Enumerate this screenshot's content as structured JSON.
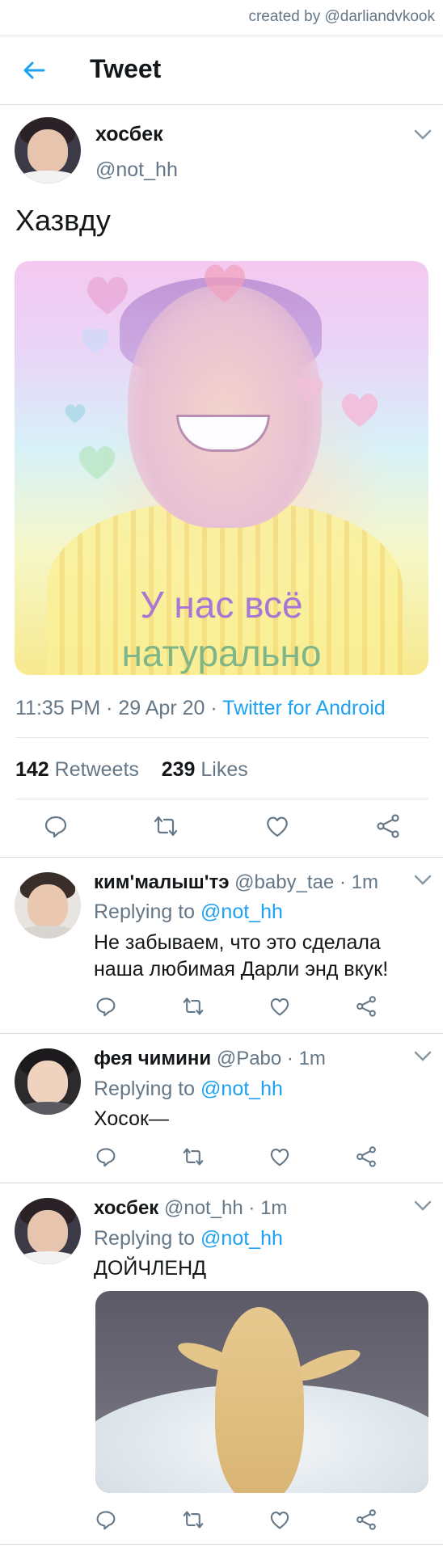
{
  "credit": "created by @darliandvkook",
  "header": {
    "title": "Tweet",
    "back_icon": "arrow-left-icon",
    "accent": "#1da1f2"
  },
  "main_tweet": {
    "display_name": "хосбек",
    "handle": "@not_hh",
    "text": "Хазвду",
    "media_caption_line1": "У нас всё",
    "media_caption_line2": "натурально",
    "time": "11:35 PM · 29 Apr 20 · ",
    "source": "Twitter for Android",
    "retweets_count": "142",
    "retweets_label": "Retweets",
    "likes_count": "239",
    "likes_label": "Likes"
  },
  "replies": [
    {
      "display_name": "ким'малыш'тэ",
      "handle_time": "@baby_tae · 1m",
      "replying_prefix": "Replying to ",
      "replying_to": "@not_hh",
      "text": "Не забываем, что это сделала наша любимая Дарли энд вкук!"
    },
    {
      "display_name": "фея чимини",
      "handle_time": "@Pabo · 1m",
      "replying_prefix": "Replying to ",
      "replying_to": "@not_hh",
      "text": "Хосок—"
    },
    {
      "display_name": "хосбек",
      "handle_time": "@not_hh · 1m",
      "replying_prefix": "Replying to ",
      "replying_to": "@not_hh",
      "text": "ДОЙЧЛЕНД"
    }
  ],
  "icons": {
    "reply": "reply-icon",
    "retweet": "retweet-icon",
    "like": "heart-icon",
    "share": "share-icon",
    "more": "chevron-down-icon"
  },
  "colors": {
    "secondary_text": "#657786",
    "link": "#1da1f2",
    "divider": "#e1e8ed"
  }
}
